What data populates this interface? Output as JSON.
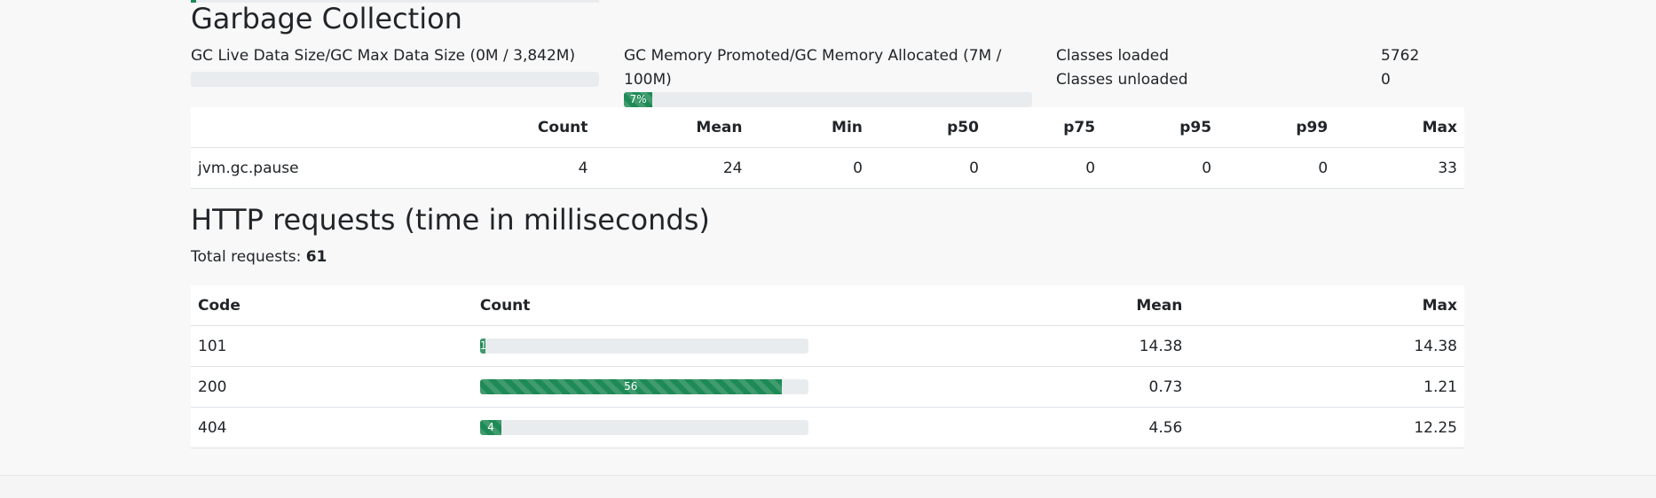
{
  "gc": {
    "title": "Garbage Collection",
    "live_label": "GC Live Data Size/GC Max Data Size (0M / 3,842M)",
    "live_fraction": 0.0,
    "promoted_label": "GC Memory Promoted/GC Memory Allocated (7M / 100M)",
    "promoted_fraction": 0.07,
    "promoted_bar_text": "7%",
    "classes_loaded_label": "Classes loaded",
    "classes_loaded_value": "5762",
    "classes_unloaded_label": "Classes unloaded",
    "classes_unloaded_value": "0",
    "table": {
      "headers": [
        "",
        "Count",
        "Mean",
        "Min",
        "p50",
        "p75",
        "p95",
        "p99",
        "Max"
      ],
      "rows": [
        [
          "jvm.gc.pause",
          "4",
          "24",
          "0",
          "0",
          "0",
          "0",
          "0",
          "33"
        ]
      ]
    }
  },
  "http": {
    "title": "HTTP requests (time in milliseconds)",
    "total_label": "Total requests:",
    "total_value": "61",
    "table": {
      "headers": [
        "Code",
        "Count",
        "Mean",
        "Max"
      ],
      "rows": [
        {
          "code": "101",
          "count": "1",
          "count_fraction": 0.0164,
          "mean": "14.38",
          "max": "14.38"
        },
        {
          "code": "200",
          "count": "56",
          "count_fraction": 0.918,
          "mean": "0.73",
          "max": "1.21"
        },
        {
          "code": "404",
          "count": "4",
          "count_fraction": 0.0656,
          "mean": "4.56",
          "max": "12.25"
        }
      ]
    }
  },
  "colors": {
    "accent": "#1e8a55",
    "track": "#e9ecef"
  }
}
